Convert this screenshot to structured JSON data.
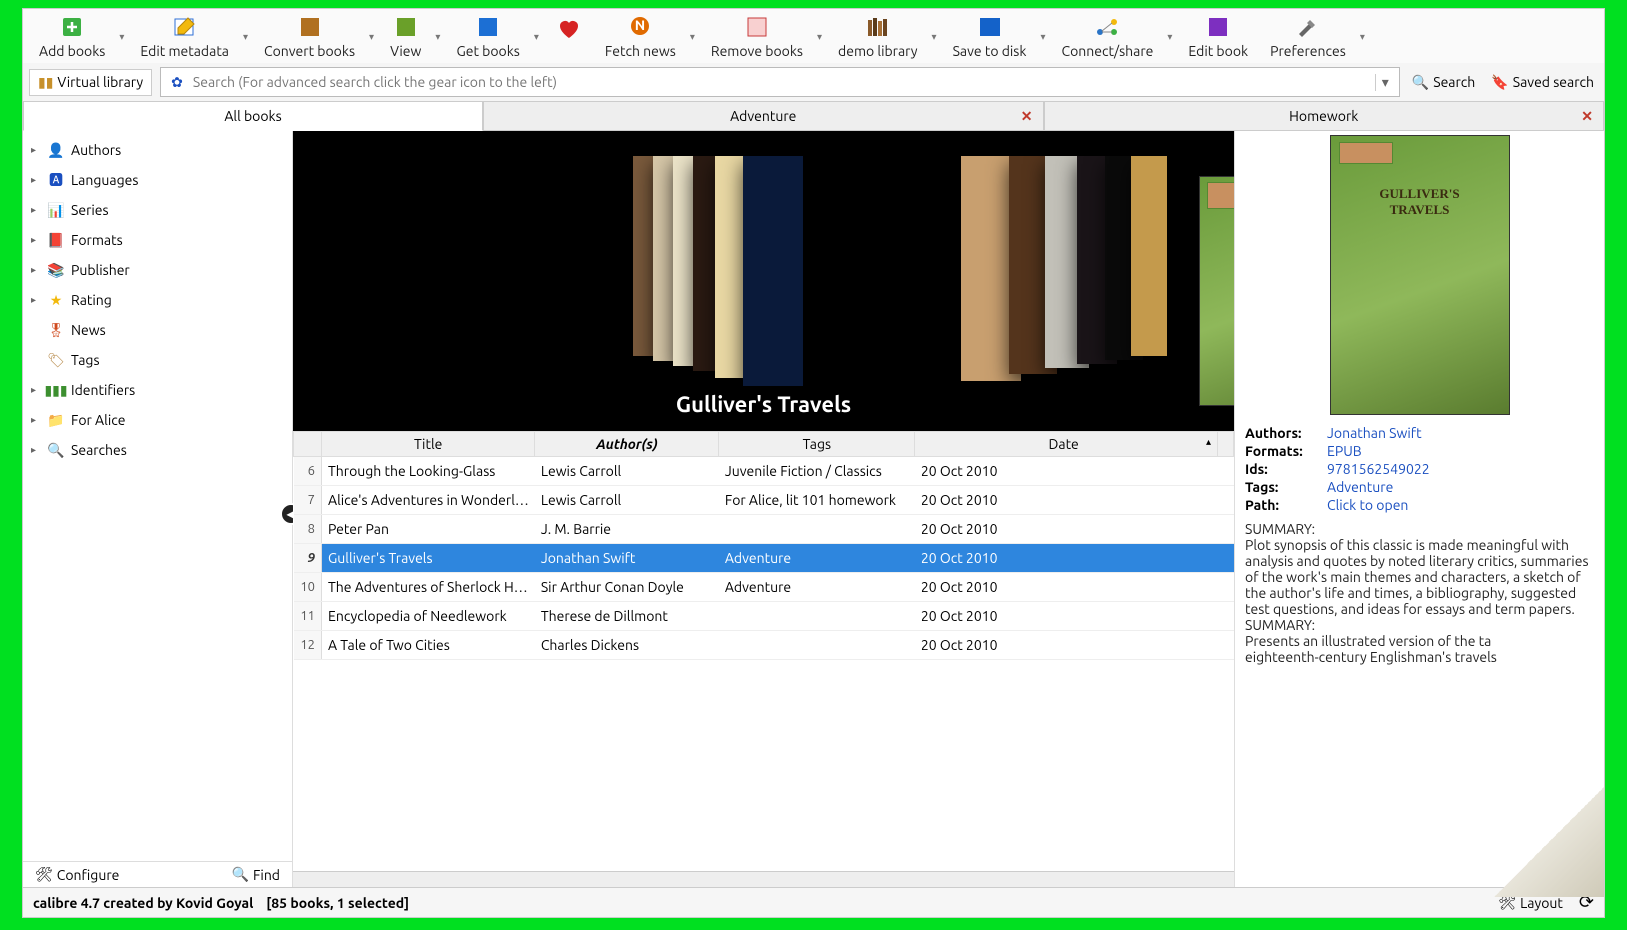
{
  "toolbar": [
    {
      "id": "add-books",
      "label": "Add books",
      "color": "#3cb043",
      "drop": true
    },
    {
      "id": "edit-metadata",
      "label": "Edit metadata",
      "color": "#2e6fd6",
      "drop": true
    },
    {
      "id": "convert-books",
      "label": "Convert books",
      "color": "#b07020",
      "drop": true
    },
    {
      "id": "view",
      "label": "View",
      "color": "#6aa029",
      "drop": true
    },
    {
      "id": "get-books",
      "label": "Get books",
      "color": "#1c6fd4",
      "drop": true
    },
    {
      "id": "heart",
      "label": "",
      "color": "#d62323",
      "drop": false
    },
    {
      "id": "fetch-news",
      "label": "Fetch news",
      "color": "#e06a00",
      "drop": true
    },
    {
      "id": "remove-books",
      "label": "Remove books",
      "color": "#c73a3a",
      "drop": true
    },
    {
      "id": "demo-library",
      "label": "demo library",
      "color": "#5a3b1a",
      "drop": true
    },
    {
      "id": "save-to-disk",
      "label": "Save to disk",
      "color": "#1462c9",
      "drop": true
    },
    {
      "id": "connect-share",
      "label": "Connect/share",
      "color": "#2a74c6",
      "drop": true
    },
    {
      "id": "edit-book",
      "label": "Edit book",
      "color": "#7d2fc0",
      "drop": false
    },
    {
      "id": "preferences",
      "label": "Preferences",
      "color": "#444",
      "drop": true
    }
  ],
  "searchrow": {
    "vlib": "Virtual library",
    "placeholder": "Search (For advanced search click the gear icon to the left)",
    "search_btn": "Search",
    "saved_btn": "Saved search"
  },
  "tabs": [
    {
      "label": "All books",
      "active": true,
      "closeable": false
    },
    {
      "label": "Adventure",
      "active": false,
      "closeable": true
    },
    {
      "label": "Homework",
      "active": false,
      "closeable": true
    }
  ],
  "sidebar": [
    {
      "label": "Authors",
      "icon": "person",
      "color": "#222"
    },
    {
      "label": "Languages",
      "icon": "lang",
      "color": "#1a4fc0"
    },
    {
      "label": "Series",
      "icon": "series",
      "color": "#1a7fd6"
    },
    {
      "label": "Formats",
      "icon": "book",
      "color": "#9e5a1e"
    },
    {
      "label": "Publisher",
      "icon": "pub",
      "color": "#3a8ec8"
    },
    {
      "label": "Rating",
      "icon": "star",
      "color": "#f2b90c"
    },
    {
      "label": "News",
      "icon": "news",
      "color": "#d04a1e",
      "arrow": false
    },
    {
      "label": "Tags",
      "icon": "tag",
      "color": "#b78a4a",
      "arrow": false
    },
    {
      "label": "Identifiers",
      "icon": "barcode",
      "color": "#3c8f2f"
    },
    {
      "label": "For Alice",
      "icon": "folder",
      "color": "#1a4fc0"
    },
    {
      "label": "Searches",
      "icon": "search",
      "color": "#2e86de"
    }
  ],
  "sidebar_foot": {
    "configure": "Configure",
    "find": "Find"
  },
  "coverflow_title": "Gulliver's Travels",
  "table": {
    "headers": [
      "",
      "Title",
      "Author(s)",
      "Tags",
      "Date"
    ],
    "sorted_col": 4,
    "rows": [
      {
        "n": 6,
        "title": "Through the Looking-Glass",
        "author": "Lewis Carroll",
        "tags": "Juvenile Fiction / Classics",
        "date": "20 Oct 2010"
      },
      {
        "n": 7,
        "title": "Alice's Adventures in Wonderl…",
        "author": "Lewis Carroll",
        "tags": "For Alice, lit 101 homework",
        "date": "20 Oct 2010"
      },
      {
        "n": 8,
        "title": "Peter Pan",
        "author": "J. M. Barrie",
        "tags": "",
        "date": "20 Oct 2010"
      },
      {
        "n": 9,
        "title": "Gulliver's Travels",
        "author": "Jonathan Swift",
        "tags": "Adventure",
        "date": "20 Oct 2010",
        "sel": true
      },
      {
        "n": 10,
        "title": "The Adventures of Sherlock H…",
        "author": "Sir Arthur Conan Doyle",
        "tags": "Adventure",
        "date": "20 Oct 2010"
      },
      {
        "n": 11,
        "title": "Encyclopedia of Needlework",
        "author": "Therese de Dillmont",
        "tags": "",
        "date": "20 Oct 2010"
      },
      {
        "n": 12,
        "title": "A Tale of Two Cities",
        "author": "Charles Dickens",
        "tags": "",
        "date": "20 Oct 2010"
      }
    ]
  },
  "details": {
    "authors_k": "Authors:",
    "authors_v": "Jonathan Swift",
    "formats_k": "Formats:",
    "formats_v": "EPUB",
    "ids_k": "Ids:",
    "ids_v": "9781562549022",
    "tags_k": "Tags:",
    "tags_v": "Adventure",
    "path_k": "Path:",
    "path_v": "Click to open",
    "summary_h": "SUMMARY:",
    "summary_1": "Plot synopsis of this classic is made meaningful with analysis and quotes by noted literary critics, summaries of the work's main themes and characters, a sketch of the author's life and times, a bibliography, suggested test questions, and ideas for essays and term papers.",
    "summary_2": "Presents an illustrated version of the ta",
    "summary_3": "eighteenth-century Englishman's travels"
  },
  "status": {
    "app": "calibre 4.7 created by Kovid Goyal",
    "count": "[85 books, 1 selected]",
    "layout": "Layout"
  }
}
